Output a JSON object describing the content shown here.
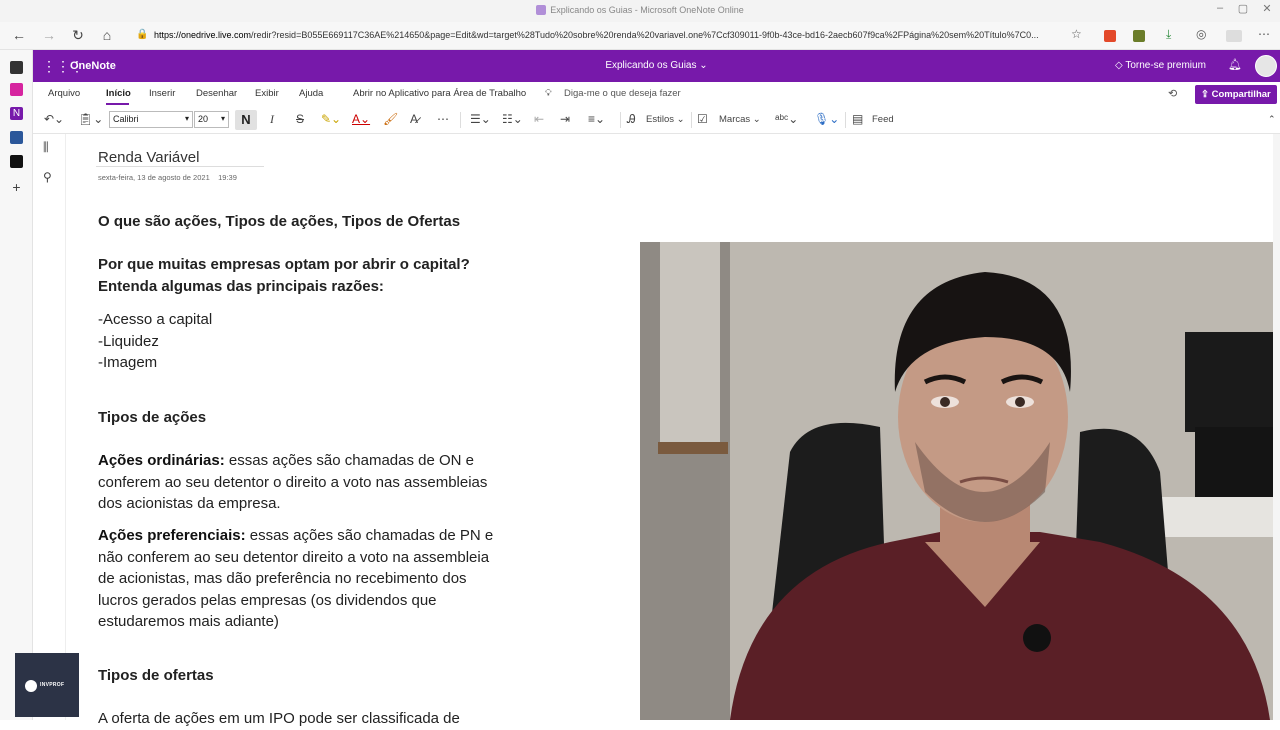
{
  "window": {
    "title": "Explicando os Guias - Microsoft OneNote Online"
  },
  "browser": {
    "url_host": "https://onedrive.live.com",
    "url_rest": "/redir?resid=B055E669117C36AE%214650&page=Edit&wd=target%28Tudo%20sobre%20renda%20variavel.one%7Ccf309011-9f0b-43ce-bd16-2aecb607f9ca%2FPágina%20sem%20Título%7C0..."
  },
  "app": {
    "name": "OneNote",
    "document": "Explicando os Guias",
    "premium": "Torne-se premium",
    "share": "Compartilhar"
  },
  "menu": {
    "items": [
      "Arquivo",
      "Início",
      "Inserir",
      "Desenhar",
      "Exibir",
      "Ajuda"
    ],
    "open_desktop": "Abrir no Aplicativo para Área de Trabalho",
    "tell_me": "Diga-me o que deseja fazer"
  },
  "ribbon": {
    "font": "Calibri",
    "size": "20",
    "bold": "N",
    "italic": "I",
    "strike": "S",
    "styles": "Estilos",
    "tags": "Marcas",
    "feed": "Feed"
  },
  "page": {
    "title": "Renda Variável",
    "date": "sexta-feira, 13 de agosto de 2021",
    "time": "19:39",
    "h1": "O que são ações, Tipos de ações, Tipos de Ofertas",
    "q1": "Por que muitas empresas optam por abrir o capital?",
    "q2": "Entenda algumas das principais razões:",
    "reasons": [
      "-Acesso a capital",
      "-Liquidez",
      "-Imagem"
    ],
    "h2": "Tipos de ações",
    "ord_label": "Ações ordinárias:",
    "ord_text": " essas ações são chamadas de ON e conferem ao seu detentor o direito a voto nas assembleias dos acionistas da empresa.",
    "pref_label": "Ações preferenciais:",
    "pref_text": " essas ações são chamadas de PN e não conferem ao seu detentor direito a voto na assembleia de acionistas, mas dão preferência no recebimento dos lucros gerados pelas empresas (os dividendos que estudaremos mais adiante)",
    "h3": "Tipos de ofertas",
    "last": "A oferta de ações em um IPO pode ser classificada de"
  },
  "brand": {
    "text": "INVPROF"
  },
  "colors": {
    "onenote_purple": "#7719aa"
  }
}
